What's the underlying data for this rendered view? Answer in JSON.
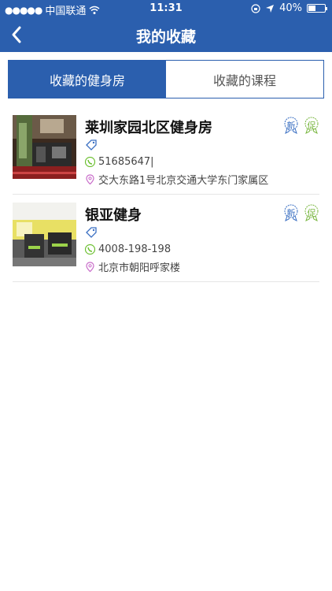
{
  "status_bar": {
    "carrier": "中国联通",
    "time": "11:31",
    "battery": "40%"
  },
  "nav": {
    "title": "我的收藏"
  },
  "tabs": [
    {
      "label": "收藏的健身房",
      "active": true
    },
    {
      "label": "收藏的课程",
      "active": false
    }
  ],
  "gyms": [
    {
      "name": "莱圳家园北区健身房",
      "phone": "51685647|",
      "address": "交大东路1号北京交通大学东门家属区",
      "badges": [
        "新",
        "促"
      ]
    },
    {
      "name": "银亚健身",
      "phone": "4008-198-198",
      "address": "北京市朝阳呼家楼",
      "badges": [
        "新",
        "促"
      ]
    }
  ],
  "colors": {
    "primary": "#2b5fae",
    "badge_new": "#3a6fc2",
    "badge_promo": "#79b640",
    "phone_icon": "#6bbf2f",
    "address_icon": "#c86bc9"
  }
}
